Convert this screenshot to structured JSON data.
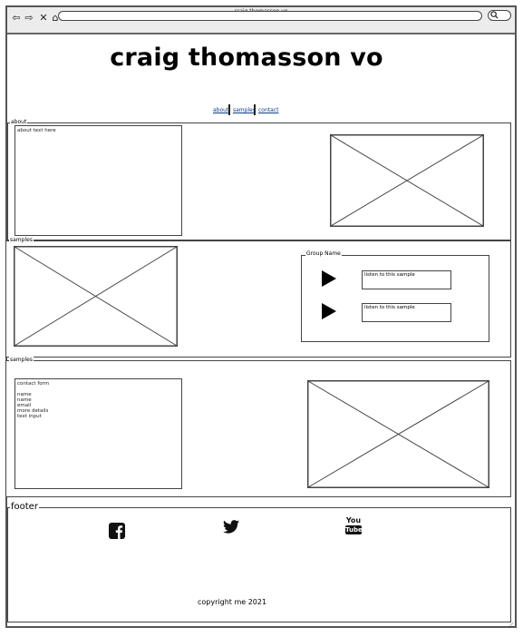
{
  "window": {
    "title": "craig thomasson vo",
    "url": ""
  },
  "header": {
    "site_title": "craig thomasson vo",
    "nav": [
      "about",
      "samples",
      "contact"
    ]
  },
  "sections": {
    "about": {
      "legend": "about",
      "text_box": "about text here"
    },
    "samples": {
      "legend": "samples",
      "group": {
        "legend": "Group Name",
        "items": [
          {
            "label": "listen to this sample"
          },
          {
            "label": "listen to this sample"
          }
        ]
      }
    },
    "contact": {
      "legend": "samples",
      "form_title": "contact form",
      "fields": [
        "name",
        "name",
        "email",
        "more details",
        "text input"
      ]
    }
  },
  "footer": {
    "legend": "footer",
    "social": [
      "facebook-icon",
      "twitter-icon",
      "youtube-icon"
    ],
    "youtube_you": "You",
    "youtube_tube": "Tube",
    "copyright": "copyright me 2021"
  },
  "colors": {
    "nav_link": "#0b3c82",
    "stroke": "#444444"
  }
}
